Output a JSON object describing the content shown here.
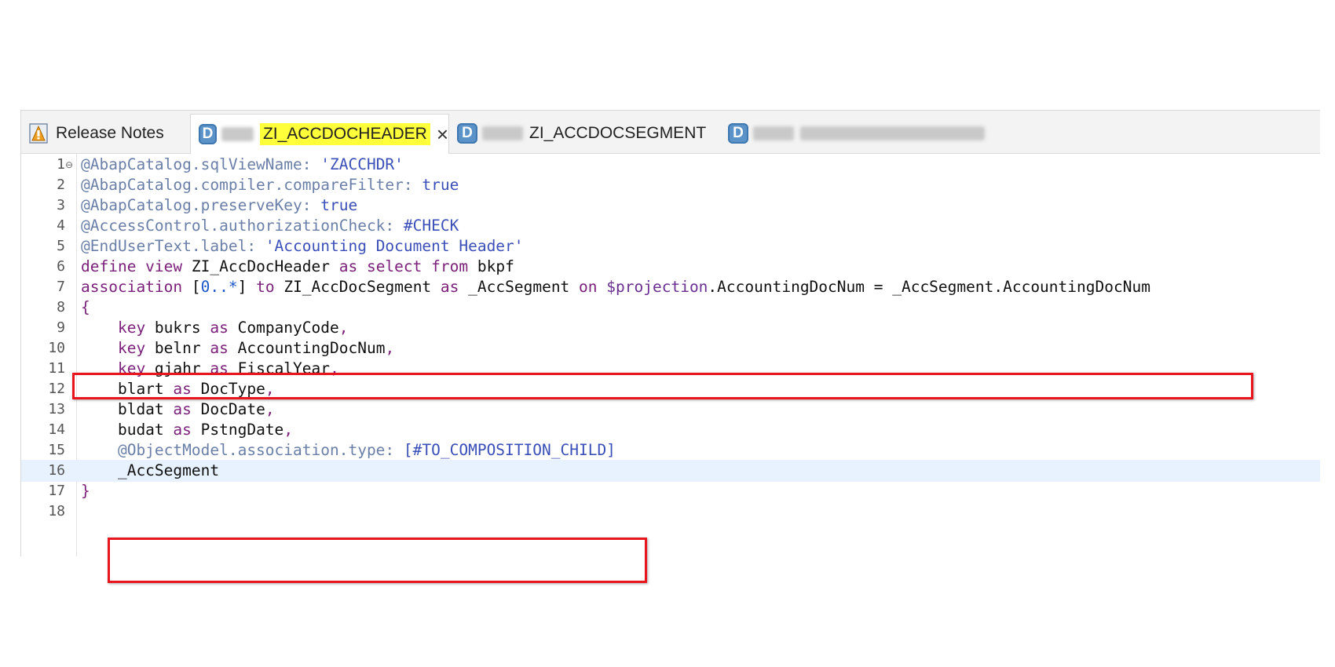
{
  "tabs": [
    {
      "label": "Release Notes",
      "icon": "release-notes-icon",
      "active": false
    },
    {
      "label": "ZI_ACCDOCHEADER",
      "icon": "ddl-source-icon",
      "active": true,
      "highlighted": true,
      "close_symbol": "×"
    },
    {
      "label": "ZI_ACCDOCSEGMENT",
      "icon": "ddl-source-icon",
      "active": false
    },
    {
      "label": "",
      "icon": "ddl-source-icon",
      "active": false,
      "obscured": true
    }
  ],
  "editor": {
    "lines": [
      {
        "num": "1",
        "fold": "⊖",
        "tokens": [
          {
            "t": "@AbapCatalog.sqlViewName: ",
            "c": "ann"
          },
          {
            "t": "'ZACCHDR'",
            "c": "str"
          }
        ]
      },
      {
        "num": "2",
        "tokens": [
          {
            "t": "@AbapCatalog.compiler.compareFilter: ",
            "c": "ann"
          },
          {
            "t": "true",
            "c": "str"
          }
        ]
      },
      {
        "num": "3",
        "tokens": [
          {
            "t": "@AbapCatalog.preserveKey: ",
            "c": "ann"
          },
          {
            "t": "true",
            "c": "str"
          }
        ]
      },
      {
        "num": "4",
        "tokens": [
          {
            "t": "@AccessControl.authorizationCheck: ",
            "c": "ann"
          },
          {
            "t": "#CHECK",
            "c": "str"
          }
        ]
      },
      {
        "num": "5",
        "tokens": [
          {
            "t": "@EndUserText.label: ",
            "c": "ann"
          },
          {
            "t": "'Accounting Document Header'",
            "c": "str"
          }
        ]
      },
      {
        "num": "6",
        "tokens": [
          {
            "t": "define view ",
            "c": "kw"
          },
          {
            "t": "ZI_AccDocHeader ",
            "c": "plain"
          },
          {
            "t": "as select from ",
            "c": "kw"
          },
          {
            "t": "bkpf",
            "c": "plain"
          }
        ]
      },
      {
        "num": "7",
        "tokens": [
          {
            "t": "association ",
            "c": "kw"
          },
          {
            "t": "[",
            "c": "plain"
          },
          {
            "t": "0..*",
            "c": "num"
          },
          {
            "t": "] ",
            "c": "plain"
          },
          {
            "t": "to ",
            "c": "kw"
          },
          {
            "t": "ZI_AccDocSegment ",
            "c": "plain"
          },
          {
            "t": "as ",
            "c": "kw"
          },
          {
            "t": "_AccSegment ",
            "c": "plain"
          },
          {
            "t": "on ",
            "c": "kw"
          },
          {
            "t": "$projection",
            "c": "var"
          },
          {
            "t": ".AccountingDocNum = _AccSegment.AccountingDocNum",
            "c": "plain"
          }
        ]
      },
      {
        "num": "8",
        "tokens": [
          {
            "t": "{",
            "c": "kw"
          }
        ]
      },
      {
        "num": "9",
        "tokens": [
          {
            "t": "    key ",
            "c": "kw"
          },
          {
            "t": "bukrs ",
            "c": "plain"
          },
          {
            "t": "as ",
            "c": "kw"
          },
          {
            "t": "CompanyCode",
            "c": "plain"
          },
          {
            "t": ",",
            "c": "kw"
          }
        ]
      },
      {
        "num": "10",
        "tokens": [
          {
            "t": "    key ",
            "c": "kw"
          },
          {
            "t": "belnr ",
            "c": "plain"
          },
          {
            "t": "as ",
            "c": "kw"
          },
          {
            "t": "AccountingDocNum",
            "c": "plain"
          },
          {
            "t": ",",
            "c": "kw"
          }
        ]
      },
      {
        "num": "11",
        "tokens": [
          {
            "t": "    key ",
            "c": "kw"
          },
          {
            "t": "gjahr ",
            "c": "plain"
          },
          {
            "t": "as ",
            "c": "kw"
          },
          {
            "t": "FiscalYear",
            "c": "plain"
          },
          {
            "t": ",",
            "c": "kw"
          }
        ]
      },
      {
        "num": "12",
        "tokens": [
          {
            "t": "    blart ",
            "c": "plain"
          },
          {
            "t": "as ",
            "c": "kw"
          },
          {
            "t": "DocType",
            "c": "plain"
          },
          {
            "t": ",",
            "c": "kw"
          }
        ]
      },
      {
        "num": "13",
        "tokens": [
          {
            "t": "    bldat ",
            "c": "plain"
          },
          {
            "t": "as ",
            "c": "kw"
          },
          {
            "t": "DocDate",
            "c": "plain"
          },
          {
            "t": ",",
            "c": "kw"
          }
        ]
      },
      {
        "num": "14",
        "tokens": [
          {
            "t": "    budat ",
            "c": "plain"
          },
          {
            "t": "as ",
            "c": "kw"
          },
          {
            "t": "PstngDate",
            "c": "plain"
          },
          {
            "t": ",",
            "c": "kw"
          }
        ]
      },
      {
        "num": "15",
        "tokens": [
          {
            "t": "    @ObjectModel.association.type: ",
            "c": "ann"
          },
          {
            "t": "[#TO_COMPOSITION_CHILD]",
            "c": "str"
          }
        ]
      },
      {
        "num": "16",
        "current": true,
        "tokens": [
          {
            "t": "    _AccSegment",
            "c": "plain"
          }
        ]
      },
      {
        "num": "17",
        "tokens": [
          {
            "t": "}",
            "c": "kw"
          }
        ]
      },
      {
        "num": "18",
        "tokens": []
      }
    ]
  },
  "colors": {
    "annotation": "#6a7fa8",
    "string": "#3a4fb8",
    "keyword": "#7b1f7a",
    "highlight_box": "#e8141e",
    "tab_highlight": "#ffff3a",
    "current_line": "#e8f2fe"
  }
}
